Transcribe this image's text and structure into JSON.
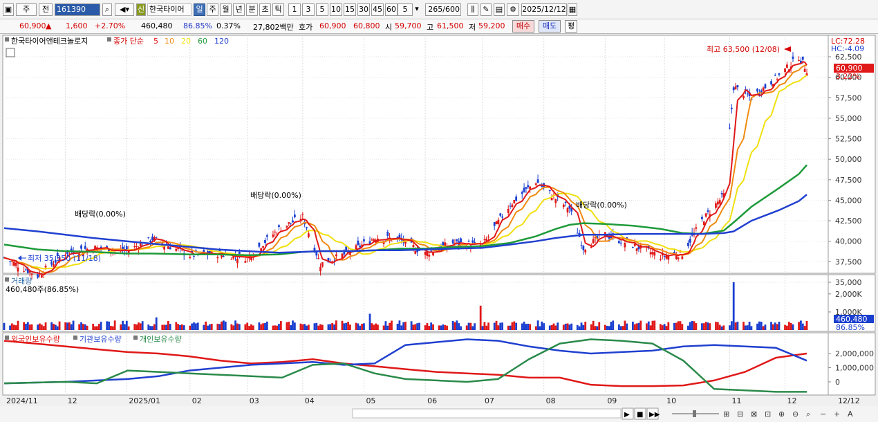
{
  "toolbar": {
    "period_label": "주",
    "prev_label": "전",
    "code": "161390",
    "credit_badge": "신",
    "stock_name": "한국타이어",
    "periods": [
      "일",
      "주",
      "월",
      "년",
      "분",
      "초",
      "틱"
    ],
    "active_period": "일",
    "intervals": [
      "1",
      "3",
      "5",
      "10",
      "15",
      "30",
      "45",
      "60"
    ],
    "custom_interval": "5",
    "count": "265",
    "count_max": "/600",
    "date": "2025/12/12"
  },
  "quote": {
    "price": "60,900",
    "arrow": "▲",
    "change": "1,600",
    "change_pct": "+2.70%",
    "volume": "460,480",
    "vol_ratio": "86.85%",
    "turnover": "0.37%",
    "amount": "27,802백만",
    "bid_label": "호가",
    "ask": "60,900",
    "bid": "60,800",
    "open_label": "시",
    "open": "59,700",
    "high_label": "고",
    "high": "61,500",
    "low_label": "저",
    "low": "59,200",
    "buy_label": "매수",
    "sell_label": "매도",
    "eval_label": "평"
  },
  "price_panel": {
    "name_legend": "한국타이어앤테크놀로지",
    "ma_legend_prefix": "종가 단순",
    "ma_labels": [
      "5",
      "10",
      "20",
      "60",
      "120"
    ],
    "ma_colors": [
      "#e01818",
      "#f08a10",
      "#f0e010",
      "#1e9a3a",
      "#2040d0"
    ],
    "lc": "LC:72.28",
    "hc": "HC:-4.09",
    "last_tag": "60,900",
    "last_pct": "3.22%",
    "y_ticks": [
      35000,
      37500,
      40000,
      42500,
      45000,
      47500,
      50000,
      52500,
      55000,
      57500,
      60000,
      62500
    ],
    "y_tick_labels": [
      "35,000",
      "37,500",
      "40,000",
      "42,500",
      "45,000",
      "47,500",
      "50,000",
      "52,500",
      "55,000",
      "57,500",
      "60,000",
      "62,500"
    ],
    "high_note": "최고 63,500 (12/08)",
    "low_note": "최저 35,350 (11/18)",
    "dividend_label": "배당락(0.00%)"
  },
  "volume_panel": {
    "title": "거래량",
    "value_note": "460,480주(86.85%)",
    "y_tick_labels": [
      "1,000K",
      "2,000K"
    ],
    "last_tag": "460,480",
    "last_pct": "86.85%"
  },
  "holdings_panel": {
    "legend": [
      "외국인보유수량",
      "기관보유수량",
      "개인보유수량"
    ],
    "colors": [
      "#e01818",
      "#2040d0",
      "#2a8a4a"
    ],
    "y_tick_labels": [
      "0",
      "1,000,000",
      "2,000,000"
    ]
  },
  "x_axis": {
    "labels": [
      "2024/11",
      "12",
      "2025/01",
      "02",
      "03",
      "04",
      "05",
      "06",
      "07",
      "08",
      "09",
      "10",
      "11",
      "12"
    ],
    "right_label": "12/12"
  },
  "chart_data": {
    "type": "candlestick",
    "title": "한국타이어앤테크놀로지",
    "x_range": [
      "2024-11-01",
      "2025-12-12"
    ],
    "ylim": [
      34000,
      64000
    ],
    "close_approx": [
      [
        "2024-11-01",
        38000
      ],
      [
        "2024-11-18",
        35800
      ],
      [
        "2024-12-02",
        38600
      ],
      [
        "2024-12-16",
        39200
      ],
      [
        "2025-01-02",
        38800
      ],
      [
        "2025-01-15",
        40300
      ],
      [
        "2025-02-03",
        38300
      ],
      [
        "2025-02-17",
        38500
      ],
      [
        "2025-03-04",
        38000
      ],
      [
        "2025-03-20",
        41500
      ],
      [
        "2025-04-01",
        43000
      ],
      [
        "2025-04-10",
        37200
      ],
      [
        "2025-04-25",
        38700
      ],
      [
        "2025-05-08",
        40500
      ],
      [
        "2025-05-20",
        40200
      ],
      [
        "2025-06-02",
        38500
      ],
      [
        "2025-06-16",
        39800
      ],
      [
        "2025-07-01",
        39500
      ],
      [
        "2025-07-15",
        44500
      ],
      [
        "2025-07-28",
        47300
      ],
      [
        "2025-08-07",
        45200
      ],
      [
        "2025-08-14",
        44000
      ],
      [
        "2025-08-21",
        39200
      ],
      [
        "2025-09-01",
        40800
      ],
      [
        "2025-09-15",
        39500
      ],
      [
        "2025-09-29",
        38200
      ],
      [
        "2025-10-10",
        38500
      ],
      [
        "2025-10-20",
        42500
      ],
      [
        "2025-10-31",
        45600
      ],
      [
        "2025-11-05",
        58800
      ],
      [
        "2025-11-14",
        57500
      ],
      [
        "2025-11-28",
        60200
      ],
      [
        "2025-12-08",
        62500
      ],
      [
        "2025-12-12",
        60900
      ]
    ],
    "high": {
      "value": 63500,
      "date": "12/08"
    },
    "low": {
      "value": 35350,
      "date": "11/18"
    },
    "series": [
      {
        "name": "5",
        "values": [
          38000,
          35800,
          38600,
          39200,
          38800,
          40300,
          38300,
          38500,
          38000,
          41500,
          43000,
          37200,
          38700,
          40500,
          40200,
          38500,
          39800,
          39500,
          44500,
          47300,
          45200,
          44000,
          39200,
          40800,
          39500,
          38200,
          38500,
          42500,
          45600,
          58800,
          57500,
          60200,
          62500,
          60900
        ]
      },
      {
        "name": "60",
        "values": [
          39600,
          39000,
          38800,
          38700,
          38500,
          38500,
          38400,
          38400,
          38300,
          38400,
          38700,
          38800,
          38800,
          38900,
          39100,
          39100,
          39300,
          39400,
          39800,
          40600,
          41500,
          42000,
          42200,
          42100,
          41900,
          41500,
          41000,
          40900,
          41300,
          42300,
          44200,
          46500,
          48200,
          49300
        ]
      },
      {
        "name": "120",
        "values": [
          41600,
          41200,
          40800,
          40400,
          40000,
          39700,
          39300,
          39000,
          38800,
          38600,
          38700,
          38800,
          38800,
          38900,
          38900,
          39000,
          39100,
          39200,
          39600,
          40000,
          40400,
          40600,
          40800,
          40800,
          40900,
          40900,
          40900,
          40900,
          41000,
          41200,
          42500,
          43800,
          44900,
          45700
        ]
      }
    ],
    "volume": {
      "unit": "K",
      "ylim": [
        0,
        2800
      ],
      "last": 460.48,
      "peak": 2650
    },
    "holdings": [
      {
        "name": "외국인보유수량",
        "values": [
          2900000,
          2700000,
          2500000,
          2300000,
          2100000,
          2000000,
          1800000,
          1500000,
          1300000,
          1400000,
          1600000,
          1300000,
          1100000,
          900000,
          700000,
          600000,
          500000,
          300000,
          300000,
          -200000,
          -300000,
          -300000,
          -250000,
          100000,
          700000,
          1700000,
          2000000
        ]
      },
      {
        "name": "기관보유수량",
        "values": [
          -100000,
          -50000,
          0,
          100000,
          200000,
          400000,
          800000,
          1000000,
          1200000,
          1300000,
          1400000,
          1200000,
          1300000,
          2600000,
          2800000,
          3000000,
          2900000,
          2500000,
          2200000,
          2000000,
          2100000,
          2200000,
          2500000,
          2600000,
          2500000,
          2400000,
          1500000
        ]
      },
      {
        "name": "개인보유수량",
        "values": [
          -100000,
          -50000,
          0,
          -100000,
          800000,
          700000,
          600000,
          500000,
          400000,
          300000,
          1200000,
          1300000,
          600000,
          200000,
          100000,
          0,
          200000,
          1600000,
          2700000,
          3000000,
          2900000,
          2700000,
          1500000,
          -500000,
          -600000,
          -700000,
          -700000
        ]
      }
    ]
  }
}
